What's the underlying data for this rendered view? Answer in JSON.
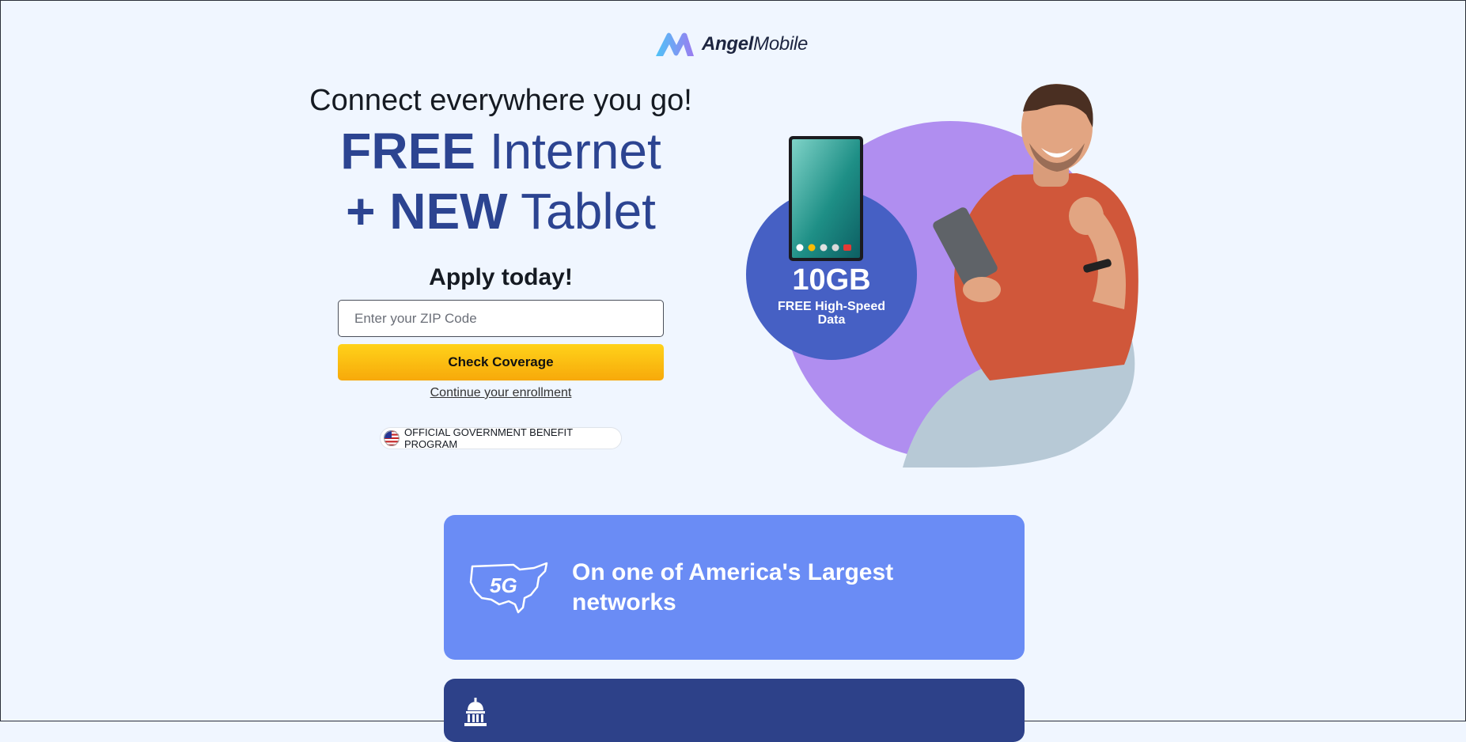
{
  "brand": {
    "name_bold": "Angel",
    "name_regular": "Mobile"
  },
  "hero": {
    "tagline": "Connect everywhere you go!",
    "line1_bold": "FREE",
    "line1_regular": "Internet",
    "line2_bold": "+ NEW",
    "line2_regular": "Tablet",
    "apply": "Apply today!"
  },
  "form": {
    "zip_placeholder": "Enter your ZIP Code",
    "zip_value": "",
    "submit_label": "Check Coverage",
    "continue_link": "Continue your enrollment"
  },
  "badge": {
    "text": "OFFICIAL GOVERNMENT BENEFIT PROGRAM",
    "icon": "us-flag-icon"
  },
  "promo": {
    "data_amount": "10GB",
    "data_label": "FREE High-Speed Data"
  },
  "features": [
    {
      "icon": "usa-5g-map-icon",
      "icon_text": "5G",
      "title": "On one of America's Largest networks"
    },
    {
      "icon": "capitol-building-icon",
      "title": ""
    }
  ],
  "colors": {
    "background": "#f0f6ff",
    "headline": "#2c4491",
    "button": "#ffc40f",
    "purple_circle": "#b08ef0",
    "blue_circle": "#4660c4",
    "card1": "#6a8cf5",
    "card2": "#2d4189"
  }
}
